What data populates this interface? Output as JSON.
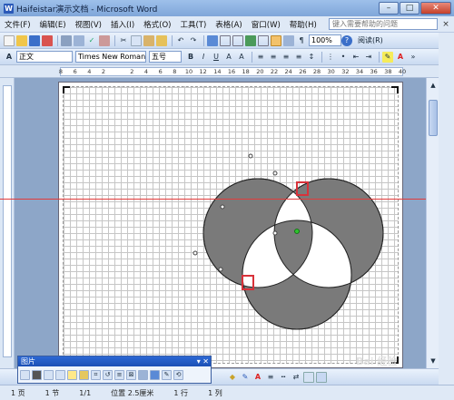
{
  "window": {
    "title": "Haifeistar演示文档 - Microsoft Word",
    "app_icon": "W"
  },
  "menu": {
    "items": [
      "文件(F)",
      "编辑(E)",
      "视图(V)",
      "插入(I)",
      "格式(O)",
      "工具(T)",
      "表格(A)",
      "窗口(W)",
      "帮助(H)"
    ],
    "help_placeholder": "键入需要帮助的问题",
    "close_glyph": "×"
  },
  "toolbar": {
    "zoom": "100%",
    "read_label": "阅读(R)"
  },
  "format_bar": {
    "style": "正文",
    "font": "Times New Roman",
    "size": "五号"
  },
  "ruler": {
    "ticks": [
      "8",
      "6",
      "4",
      "2",
      "",
      "2",
      "4",
      "6",
      "8",
      "10",
      "12",
      "14",
      "16",
      "18",
      "20",
      "22",
      "24",
      "26",
      "28",
      "30",
      "32",
      "34",
      "36",
      "38",
      "40"
    ]
  },
  "picture_toolbar": {
    "title": "图片"
  },
  "status": {
    "page": "1 页",
    "section": "1 节",
    "page_of": "1/1",
    "position": "位置 2.5厘米",
    "line": "1 行",
    "column": "1 列"
  },
  "watermark": "Bai 经验"
}
